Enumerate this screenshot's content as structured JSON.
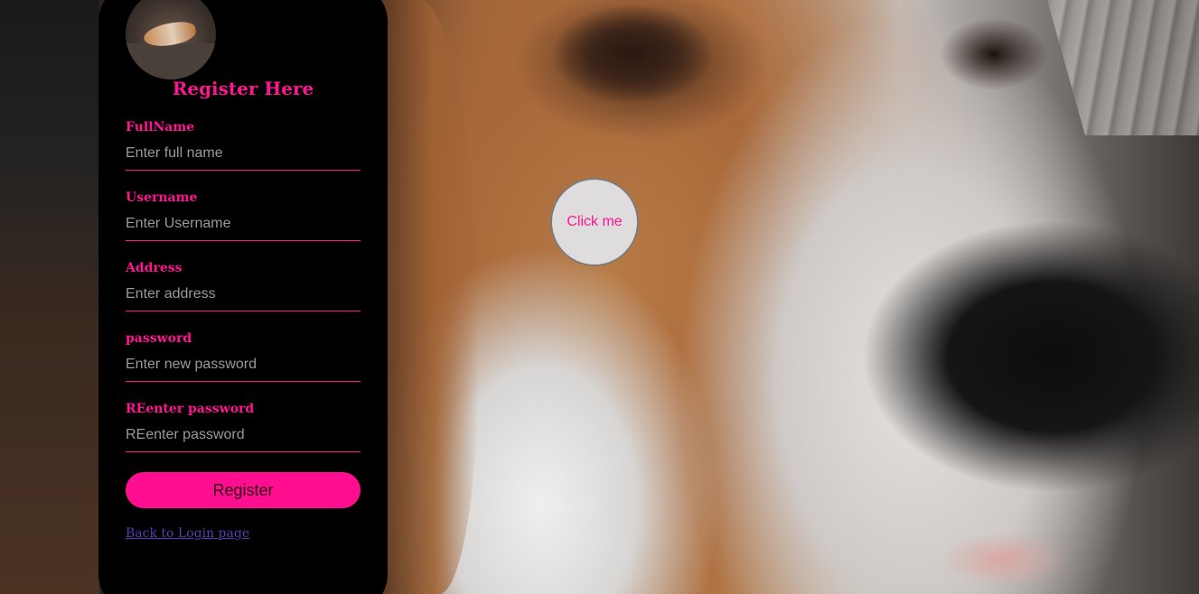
{
  "form": {
    "title": "Register Here",
    "fields": [
      {
        "label": "FullName",
        "placeholder": "Enter full name",
        "value": ""
      },
      {
        "label": "Username",
        "placeholder": "Enter Username",
        "value": ""
      },
      {
        "label": "Address",
        "placeholder": "Enter address",
        "value": ""
      },
      {
        "label": "password",
        "placeholder": "Enter new password",
        "value": ""
      },
      {
        "label": "REenter password",
        "placeholder": "REenter password",
        "value": ""
      }
    ],
    "register_label": "Register",
    "back_link": "Back to Login page"
  },
  "floating_button": {
    "label": "Click me"
  },
  "colors": {
    "accent": "#ff1493",
    "panel": "#000000",
    "link": "#5a3bb0",
    "floating_button_bg": "#dedcdc"
  },
  "icons": {
    "avatar": "dog-photo-avatar"
  }
}
